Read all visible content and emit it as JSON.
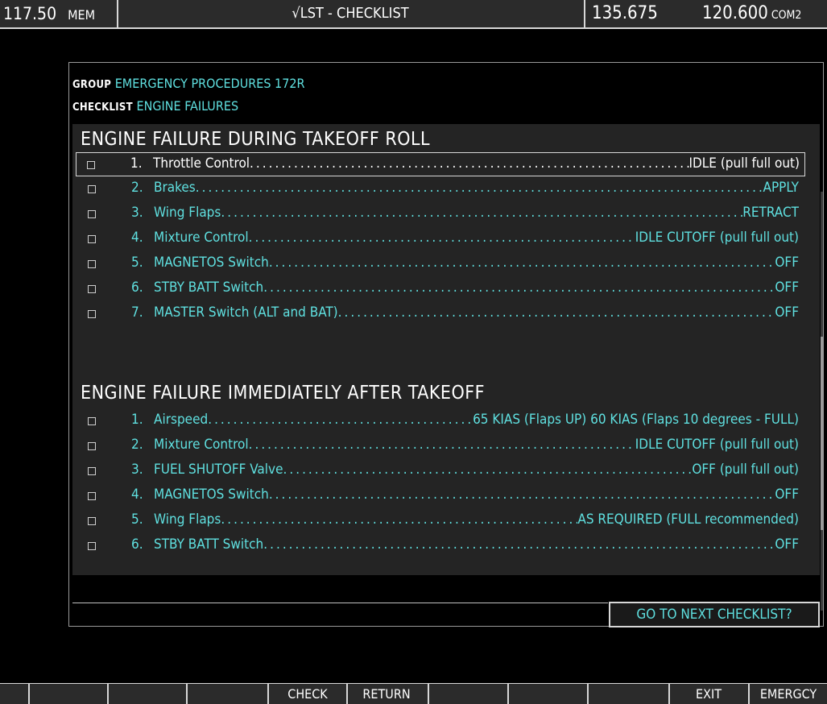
{
  "topbar": {
    "com_freq_left": "117.50",
    "mem_label": "MEM",
    "title": "√LST - CHECKLIST",
    "freq_standby": "135.675",
    "freq_active": "120.600",
    "com_label": "COM2"
  },
  "header": {
    "group_key": "GROUP",
    "group_value": "EMERGENCY PROCEDURES 172R",
    "checklist_key": "CHECKLIST",
    "checklist_value": "ENGINE FAILURES"
  },
  "sections": [
    {
      "title": "ENGINE FAILURE DURING TAKEOFF ROLL",
      "items": [
        {
          "num": "1.",
          "label": "Throttle Control",
          "action": "IDLE (pull full out)"
        },
        {
          "num": "2.",
          "label": "Brakes",
          "action": "APPLY"
        },
        {
          "num": "3.",
          "label": "Wing Flaps",
          "action": "RETRACT"
        },
        {
          "num": "4.",
          "label": "Mixture Control",
          "action": "IDLE CUTOFF (pull full out)"
        },
        {
          "num": "5.",
          "label": "MAGNETOS Switch",
          "action": "OFF"
        },
        {
          "num": "6.",
          "label": "STBY BATT Switch",
          "action": "OFF"
        },
        {
          "num": "7.",
          "label": "MASTER Switch (ALT and BAT)",
          "action": "OFF"
        }
      ]
    },
    {
      "title": "ENGINE FAILURE IMMEDIATELY AFTER TAKEOFF",
      "items": [
        {
          "num": "1.",
          "label": "Airspeed",
          "action": "65 KIAS (Flaps UP) 60 KIAS (Flaps 10 degrees - FULL)"
        },
        {
          "num": "2.",
          "label": "Mixture Control",
          "action": "IDLE CUTOFF (pull full out)"
        },
        {
          "num": "3.",
          "label": "FUEL SHUTOFF Valve",
          "action": "OFF (pull full out)"
        },
        {
          "num": "4.",
          "label": "MAGNETOS Switch",
          "action": "OFF"
        },
        {
          "num": "5.",
          "label": "Wing Flaps",
          "action": "AS REQUIRED (FULL recommended)"
        },
        {
          "num": "6.",
          "label": "STBY BATT Switch",
          "action": "OFF"
        }
      ]
    }
  ],
  "next_button": "GO TO NEXT CHECKLIST?",
  "softkeys": [
    "",
    "",
    "",
    "CHECK",
    "RETURN",
    "",
    "",
    "",
    "EXIT",
    "EMERGCY"
  ]
}
